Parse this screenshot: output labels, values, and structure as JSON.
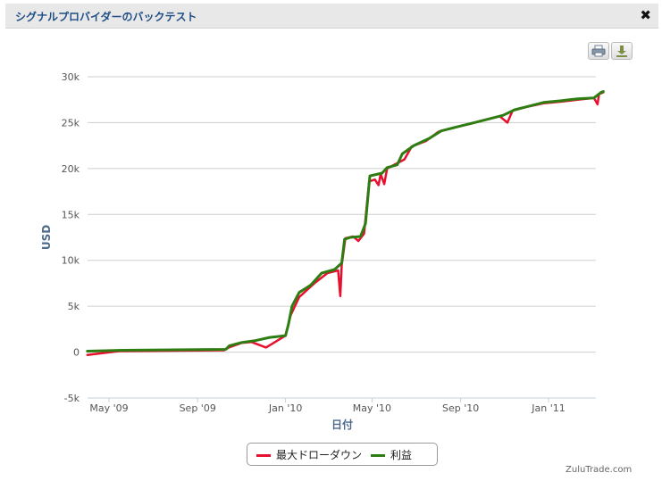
{
  "dialog": {
    "title": "シグナルプロバイダーのバックテスト",
    "close_symbol": "✖"
  },
  "toolbar": {
    "print_icon": "printer-icon",
    "download_icon": "download-icon"
  },
  "credits": "ZuluTrade.com",
  "chart_data": {
    "type": "line",
    "xlabel": "日付",
    "ylabel": "USD",
    "ylim": [
      -5000,
      30000
    ],
    "yticks": [
      "-5k",
      "0",
      "5k",
      "10k",
      "15k",
      "20k",
      "25k",
      "30k"
    ],
    "xticks": [
      "May '09",
      "Sep '09",
      "Jan '10",
      "May '10",
      "Sep '10",
      "Jan '11"
    ],
    "grid": true,
    "legend_placement": "bottom-center",
    "series": [
      {
        "name": "最大ドローダウン",
        "color": "#e8102e",
        "values": [
          [
            "2009-04-01",
            -300
          ],
          [
            "2009-05-15",
            100
          ],
          [
            "2009-10-08",
            200
          ],
          [
            "2009-10-14",
            500
          ],
          [
            "2009-11-01",
            1000
          ],
          [
            "2009-11-15",
            1100
          ],
          [
            "2009-12-05",
            500
          ],
          [
            "2010-01-01",
            1800
          ],
          [
            "2010-01-08",
            4000
          ],
          [
            "2010-01-20",
            6000
          ],
          [
            "2010-02-10",
            7500
          ],
          [
            "2010-02-28",
            8600
          ],
          [
            "2010-03-15",
            8900
          ],
          [
            "2010-03-18",
            6100
          ],
          [
            "2010-03-20",
            9500
          ],
          [
            "2010-03-25",
            12400
          ],
          [
            "2010-04-05",
            12600
          ],
          [
            "2010-04-12",
            12100
          ],
          [
            "2010-04-20",
            12900
          ],
          [
            "2010-04-27",
            18600
          ],
          [
            "2010-05-05",
            18800
          ],
          [
            "2010-05-10",
            18200
          ],
          [
            "2010-05-13",
            19400
          ],
          [
            "2010-05-18",
            18300
          ],
          [
            "2010-05-22",
            20000
          ],
          [
            "2010-06-15",
            21000
          ],
          [
            "2010-06-25",
            22400
          ],
          [
            "2010-07-15",
            23000
          ],
          [
            "2010-08-01",
            24000
          ],
          [
            "2010-08-20",
            24400
          ],
          [
            "2010-09-15",
            24900
          ],
          [
            "2010-10-05",
            25300
          ],
          [
            "2010-10-25",
            25700
          ],
          [
            "2010-11-05",
            25000
          ],
          [
            "2010-11-12",
            26300
          ],
          [
            "2010-12-01",
            26700
          ],
          [
            "2010-12-25",
            27100
          ],
          [
            "2011-01-20",
            27300
          ],
          [
            "2011-02-10",
            27500
          ],
          [
            "2011-03-05",
            27700
          ],
          [
            "2011-03-10",
            27000
          ],
          [
            "2011-03-12",
            28100
          ],
          [
            "2011-03-18",
            28300
          ]
        ]
      },
      {
        "name": "利益",
        "color": "#2e7d12",
        "values": [
          [
            "2009-04-01",
            100
          ],
          [
            "2009-05-20",
            200
          ],
          [
            "2009-10-10",
            300
          ],
          [
            "2009-10-15",
            700
          ],
          [
            "2009-11-01",
            1050
          ],
          [
            "2009-11-20",
            1250
          ],
          [
            "2009-12-10",
            1600
          ],
          [
            "2010-01-01",
            1800
          ],
          [
            "2010-01-05",
            3000
          ],
          [
            "2010-01-10",
            5000
          ],
          [
            "2010-01-20",
            6500
          ],
          [
            "2010-02-05",
            7300
          ],
          [
            "2010-02-20",
            8600
          ],
          [
            "2010-03-10",
            9000
          ],
          [
            "2010-03-20",
            9700
          ],
          [
            "2010-03-24",
            12300
          ],
          [
            "2010-04-01",
            12500
          ],
          [
            "2010-04-15",
            12600
          ],
          [
            "2010-04-22",
            14000
          ],
          [
            "2010-04-28",
            19200
          ],
          [
            "2010-05-15",
            19500
          ],
          [
            "2010-05-22",
            20100
          ],
          [
            "2010-06-05",
            20400
          ],
          [
            "2010-06-12",
            21600
          ],
          [
            "2010-06-28",
            22500
          ],
          [
            "2010-07-20",
            23300
          ],
          [
            "2010-08-05",
            24100
          ],
          [
            "2010-08-25",
            24500
          ],
          [
            "2010-09-20",
            25000
          ],
          [
            "2010-10-10",
            25400
          ],
          [
            "2010-10-30",
            25800
          ],
          [
            "2010-11-15",
            26400
          ],
          [
            "2010-12-05",
            26800
          ],
          [
            "2010-12-25",
            27200
          ],
          [
            "2011-01-20",
            27400
          ],
          [
            "2011-02-10",
            27600
          ],
          [
            "2011-03-05",
            27700
          ],
          [
            "2011-03-15",
            28300
          ],
          [
            "2011-03-18",
            28400
          ]
        ]
      }
    ]
  }
}
